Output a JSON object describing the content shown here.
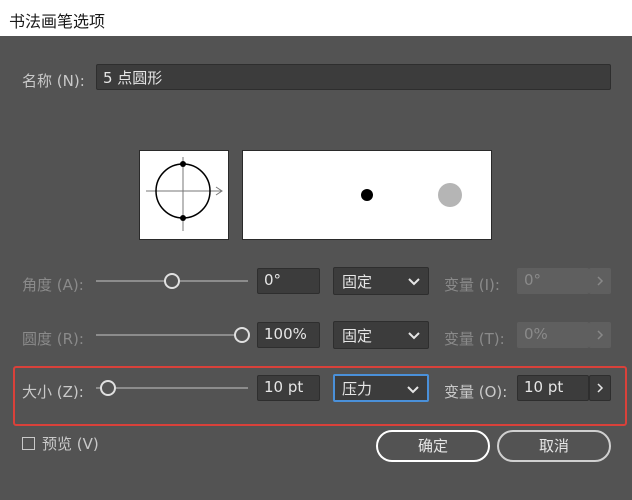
{
  "window": {
    "title": "书法画笔选项"
  },
  "name_row": {
    "label": "名称 (N):",
    "value": "5 点圆形"
  },
  "angle_row": {
    "label": "角度 (A):",
    "value": "0°",
    "mode": "固定",
    "variation_label": "变量 (I):",
    "variation_value": "0°",
    "slider_fraction": 0.5
  },
  "roundness_row": {
    "label": "圆度 (R):",
    "value": "100%",
    "mode": "固定",
    "variation_label": "变量 (T):",
    "variation_value": "0%",
    "slider_fraction": 1.0
  },
  "size_row": {
    "label": "大小 (Z):",
    "value": "10 pt",
    "mode": "压力",
    "variation_label": "变量 (O):",
    "variation_value": "10 pt",
    "slider_fraction": 0.0
  },
  "preview": {
    "label": "预览 (V)",
    "checked": false
  },
  "buttons": {
    "ok": "确定",
    "cancel": "取消"
  },
  "colors": {
    "background": "#535353",
    "highlight": "#d9413a",
    "focus": "#4a90d9"
  }
}
